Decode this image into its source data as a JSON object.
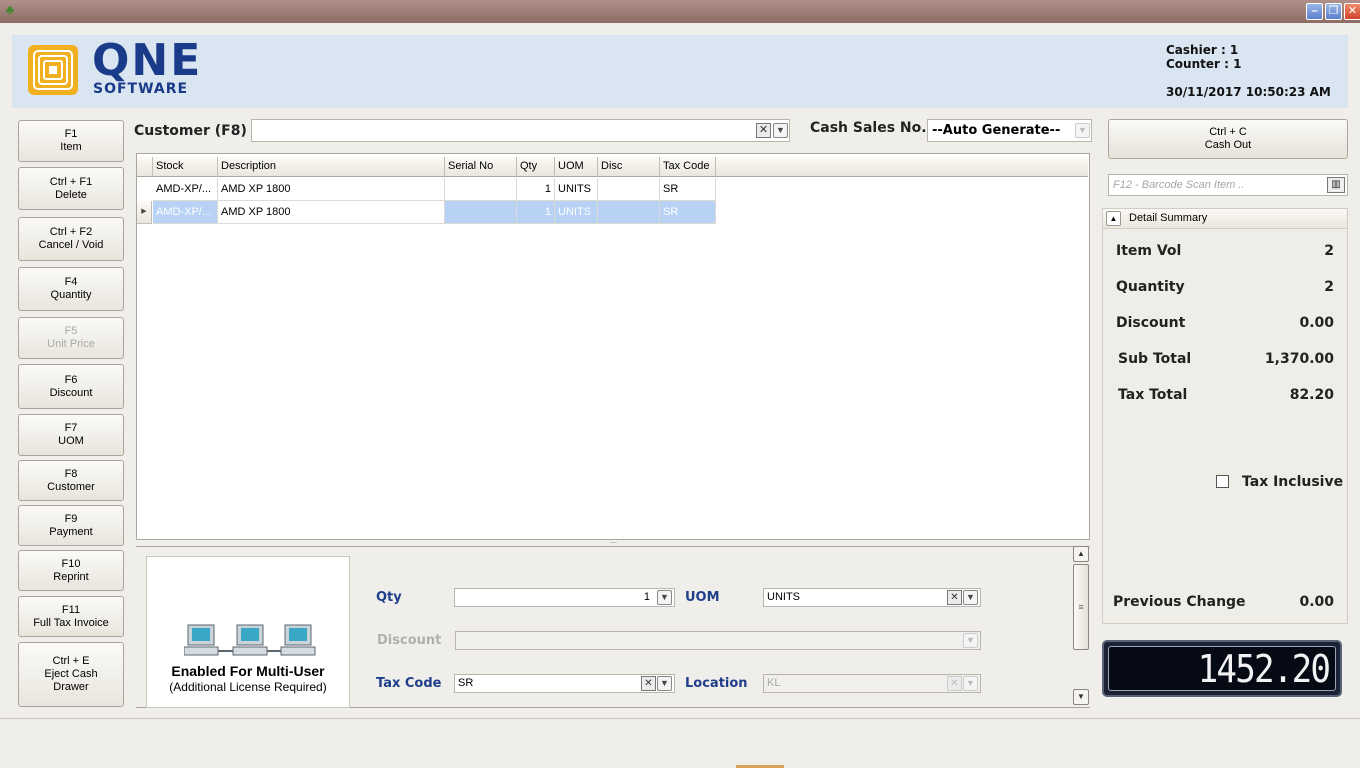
{
  "header": {
    "logo_big": "QNE",
    "logo_small": "SOFTWARE",
    "cashier": "Cashier : 1",
    "counter": "Counter : 1",
    "datetime": "30/11/2017 10:50:23 AM"
  },
  "function_buttons": [
    {
      "key": "F1",
      "label": "Item"
    },
    {
      "key": "Ctrl + F1",
      "label": "Delete"
    },
    {
      "key": "Ctrl + F2",
      "label": "Cancel / Void"
    },
    {
      "key": "F4",
      "label": "Quantity"
    },
    {
      "key": "F5",
      "label": "Unit Price",
      "disabled": true
    },
    {
      "key": "F6",
      "label": "Discount"
    },
    {
      "key": "F7",
      "label": "UOM"
    },
    {
      "key": "F8",
      "label": "Customer"
    },
    {
      "key": "F9",
      "label": "Payment"
    },
    {
      "key": "F10",
      "label": "Reprint"
    },
    {
      "key": "F11",
      "label": "Full Tax Invoice"
    },
    {
      "key": "Ctrl + E",
      "label": "Eject Cash",
      "label2": "Drawer"
    }
  ],
  "customer": {
    "label": "Customer (F8)",
    "value": ""
  },
  "cash_sales": {
    "label": "Cash Sales No.",
    "value": "--Auto Generate--"
  },
  "grid": {
    "columns": [
      "Stock",
      "Description",
      "Serial No",
      "Qty",
      "UOM",
      "Disc",
      "Tax Code"
    ],
    "rows": [
      {
        "stock": "AMD-XP/...",
        "description": "AMD XP 1800",
        "serial": "",
        "qty": "1",
        "uom": "UNITS",
        "disc": "",
        "tax": "SR"
      },
      {
        "stock": "AMD-XP/...",
        "description": "AMD XP 1800",
        "serial": "",
        "qty": "1",
        "uom": "UNITS",
        "disc": "",
        "tax": "SR"
      }
    ]
  },
  "multi_user": {
    "title": "Enabled For Multi-User",
    "subtitle": "(Additional License Required)"
  },
  "detail": {
    "qty_label": "Qty",
    "qty_value": "1",
    "uom_label": "UOM",
    "uom_value": "UNITS",
    "discount_label": "Discount",
    "discount_value": "",
    "taxcode_label": "Tax Code",
    "taxcode_value": "SR",
    "location_label": "Location",
    "location_value": "KL"
  },
  "cashout": {
    "key": "Ctrl + C",
    "label": "Cash Out"
  },
  "barcode": {
    "placeholder": "F12 - Barcode Scan Item .."
  },
  "summary": {
    "title": "Detail Summary",
    "item_vol_label": "Item Vol",
    "item_vol": "2",
    "quantity_label": "Quantity",
    "quantity": "2",
    "discount_label": "Discount",
    "discount": "0.00",
    "subtotal_label": "Sub Total",
    "subtotal": "1,370.00",
    "taxtotal_label": "Tax Total",
    "taxtotal": "82.20",
    "tax_inclusive_label": "Tax Inclusive",
    "tax_inclusive": false,
    "prev_change_label": "Previous Change",
    "prev_change": "0.00"
  },
  "display_total": "1452.20",
  "colors": {
    "header_bg": "#d9e5f1",
    "logo_blue": "#1a3a8a",
    "logo_gold": "#f0b020",
    "field_label_blue": "#1f3f8a",
    "selected_row": "#b7d2f5"
  }
}
